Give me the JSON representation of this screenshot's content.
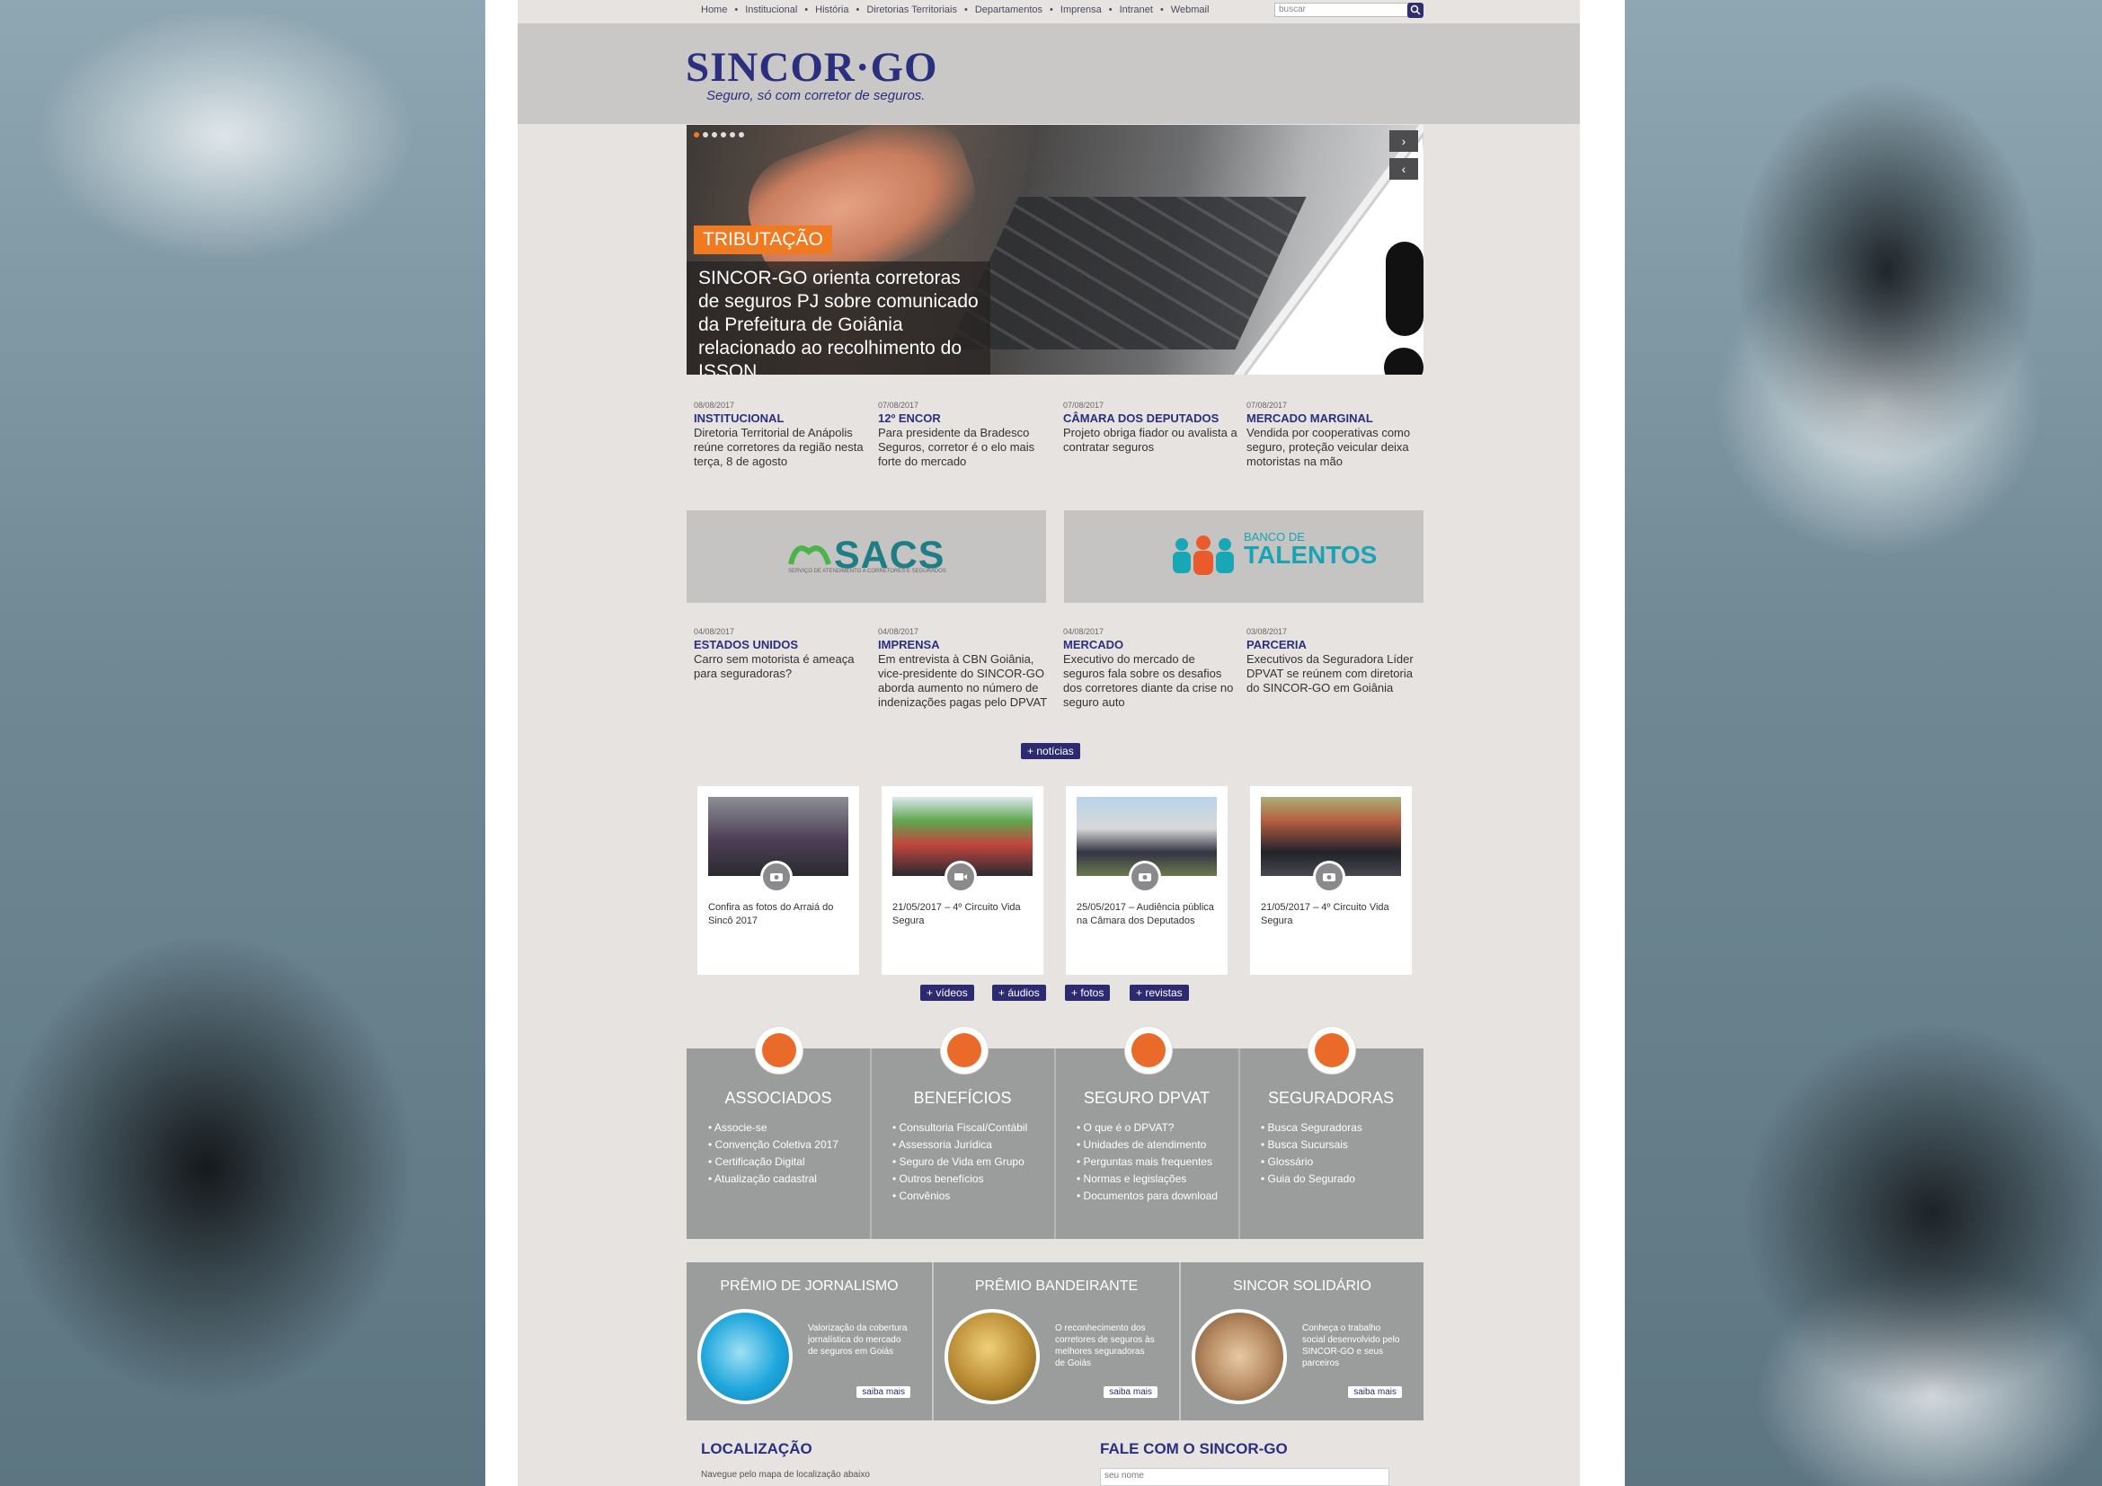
{
  "topnav": [
    "Home",
    "Institucional",
    "História",
    "Diretorias Territoriais",
    "Departamentos",
    "Imprensa",
    "Intranet",
    "Webmail"
  ],
  "search": {
    "placeholder": "buscar"
  },
  "logo": {
    "name": "SINCOR·GO",
    "tagline": "Seguro, só com corretor de seguros."
  },
  "hero": {
    "tag": "TRIBUTAÇÃO",
    "title": "SINCOR-GO orienta corretoras de seguros PJ sobre comunicado da Prefeitura de Goiânia relacionado ao recolhimento do ISSQN",
    "next": "›",
    "prev": "‹"
  },
  "news_row1": [
    {
      "date": "08/08/2017",
      "cat": "INSTITUCIONAL",
      "text": "Diretoria Territorial de Anápolis reúne corretores da região nesta terça, 8 de agosto"
    },
    {
      "date": "07/08/2017",
      "cat": "12º ENCOR",
      "text": "Para presidente da Bradesco Seguros, corretor é o elo mais forte do mercado"
    },
    {
      "date": "07/08/2017",
      "cat": "CÂMARA DOS DEPUTADOS",
      "text": "Projeto obriga fiador ou avalista a contratar seguros"
    },
    {
      "date": "07/08/2017",
      "cat": "MERCADO MARGINAL",
      "text": "Vendida por cooperativas como seguro, proteção veicular deixa motoristas na mão"
    }
  ],
  "banners": {
    "sacs": "SACS",
    "sacs_sub": "SERVIÇO DE ATENDIMENTO A CORRETORES E SEGURADOS",
    "talentos_top": "BANCO DE",
    "talentos": "TALENTOS"
  },
  "news_row2": [
    {
      "date": "04/08/2017",
      "cat": "ESTADOS UNIDOS",
      "text": "Carro sem motorista é ameaça para seguradoras?"
    },
    {
      "date": "04/08/2017",
      "cat": "IMPRENSA",
      "text": "Em entrevista à CBN Goiânia, vice-presidente do SINCOR-GO aborda aumento no número de indenizações pagas pelo DPVAT"
    },
    {
      "date": "04/08/2017",
      "cat": "MERCADO",
      "text": "Executivo do mercado de seguros fala sobre os desafios dos corretores diante da crise no seguro auto"
    },
    {
      "date": "03/08/2017",
      "cat": "PARCERIA",
      "text": "Executivos da Seguradora Líder DPVAT se reúnem com diretoria do SINCOR-GO em Goiânia"
    }
  ],
  "more_news": "+ notícias",
  "media": [
    {
      "caption": "Confira as fotos do Arraiá do Sincô 2017"
    },
    {
      "caption": "21/05/2017 – 4º Circuito Vida Segura"
    },
    {
      "caption": "25/05/2017 – Audiência pública na Câmara dos Deputados"
    },
    {
      "caption": "21/05/2017 – 4º Circuito Vida Segura"
    }
  ],
  "media_buttons": [
    "+ vídeos",
    "+ áudios",
    "+ fotos",
    "+ revistas"
  ],
  "categories": [
    {
      "title": "ASSOCIADOS",
      "items": [
        "• Associe-se",
        "• Convenção Coletiva 2017",
        "• Certificação Digital",
        "• Atualização cadastral"
      ]
    },
    {
      "title": "BENEFÍCIOS",
      "items": [
        "• Consultoria Fiscal/Contábil",
        "• Assessoria Jurídica",
        "• Seguro de Vida em Grupo",
        "• Outros benefícios",
        "• Convênios"
      ]
    },
    {
      "title": "SEGURO DPVAT",
      "items": [
        "• O que é o DPVAT?",
        "• Unidades de atendimento",
        "• Perguntas mais frequentes",
        "• Normas e legislações",
        "• Documentos para download"
      ]
    },
    {
      "title": "SEGURADORAS",
      "items": [
        "• Busca Seguradoras",
        "• Busca Sucursais",
        "• Glossário",
        "• Guia do Segurado"
      ]
    }
  ],
  "premios": [
    {
      "title": "PRÊMIO DE JORNALISMO",
      "desc": "Valorização da cobertura jornalística do mercado de seguros em Goiás",
      "btn": "saiba mais"
    },
    {
      "title": "PRÊMIO BANDEIRANTE",
      "desc": "O reconhecimento dos corretores de seguros às melhores seguradoras de Goiás",
      "btn": "saiba mais"
    },
    {
      "title": "SINCOR SOLIDÁRIO",
      "desc": "Conheça o trabalho social desenvolvido pelo SINCOR-GO e seus parceiros",
      "btn": "saiba mais"
    }
  ],
  "footer": {
    "loc": "LOCALIZAÇÃO",
    "loc_sub": "Navegue pelo mapa de localização abaixo",
    "contact": "FALE COM O SINCOR-GO",
    "name_placeholder": "seu nome"
  },
  "colors": {
    "brand": "#2a2f7f",
    "accent": "#ef7a22",
    "button": "#2c2b72"
  }
}
